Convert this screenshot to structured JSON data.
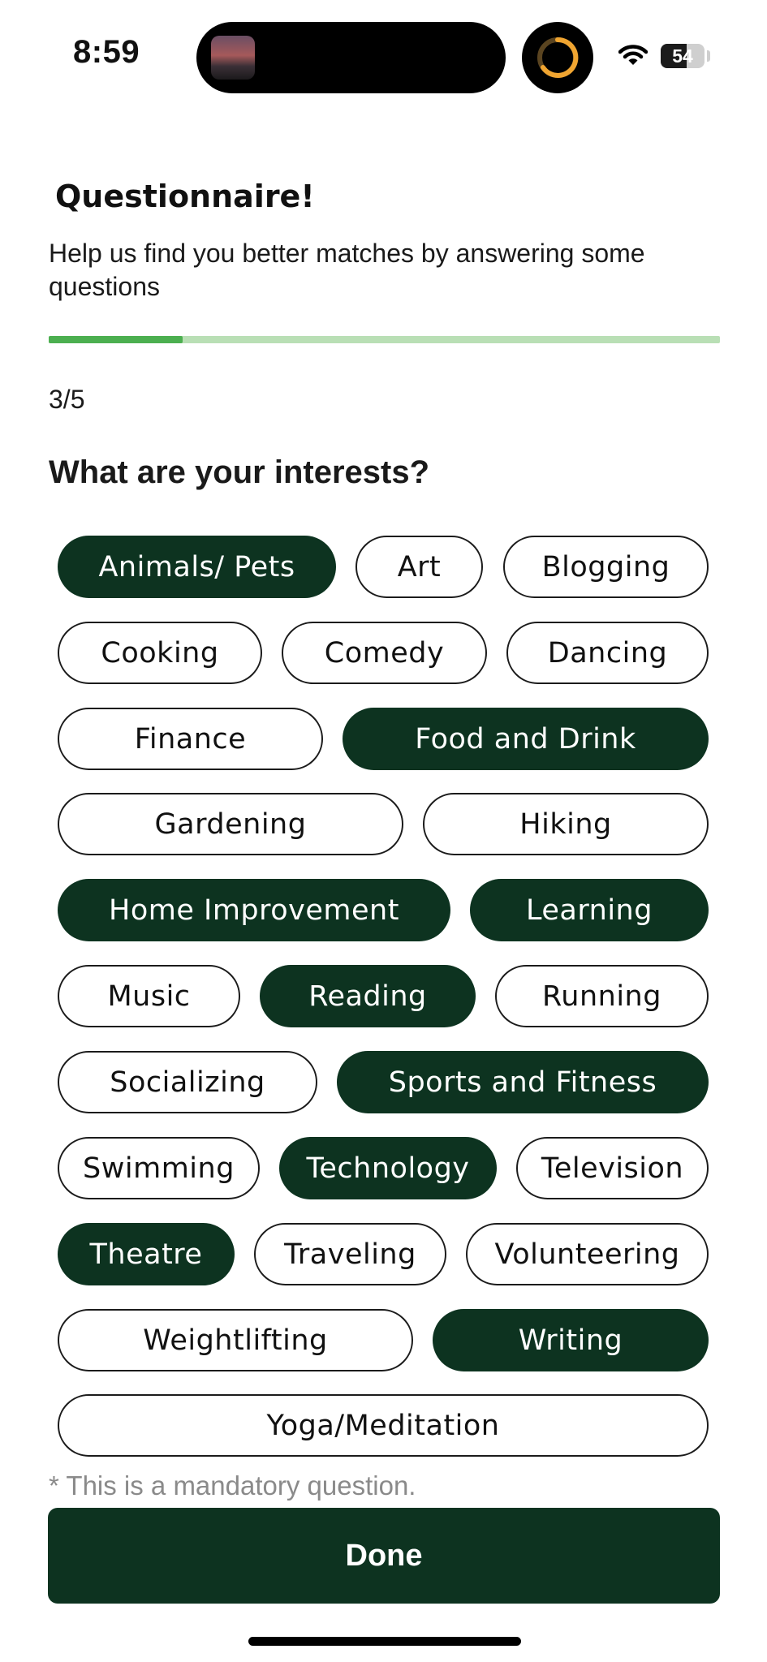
{
  "status_bar": {
    "time": "8:59",
    "battery": "54",
    "icons": [
      "photo-thumbnail-icon",
      "timer-ring-icon",
      "wifi-icon",
      "battery-icon"
    ]
  },
  "header": {
    "title": "Questionnaire!",
    "subtitle": "Help us find you better matches by answering some questions"
  },
  "progress": {
    "fraction": 0.2,
    "step_label": "3/5",
    "track_color": "#b9dfb5",
    "fill_color": "#4caf50"
  },
  "question": "What are your interests?",
  "interests": [
    {
      "label": "Animals/ Pets",
      "selected": true
    },
    {
      "label": "Art",
      "selected": false
    },
    {
      "label": "Blogging",
      "selected": false
    },
    {
      "label": "Cooking",
      "selected": false
    },
    {
      "label": "Comedy",
      "selected": false
    },
    {
      "label": "Dancing",
      "selected": false
    },
    {
      "label": "Finance",
      "selected": false
    },
    {
      "label": "Food and Drink",
      "selected": true
    },
    {
      "label": "Gardening",
      "selected": false
    },
    {
      "label": "Hiking",
      "selected": false
    },
    {
      "label": "Home Improvement",
      "selected": true
    },
    {
      "label": "Learning",
      "selected": true
    },
    {
      "label": "Music",
      "selected": false
    },
    {
      "label": "Reading",
      "selected": true
    },
    {
      "label": "Running",
      "selected": false
    },
    {
      "label": "Socializing",
      "selected": false
    },
    {
      "label": "Sports and Fitness",
      "selected": true
    },
    {
      "label": "Swimming",
      "selected": false
    },
    {
      "label": "Technology",
      "selected": true
    },
    {
      "label": "Television",
      "selected": false
    },
    {
      "label": "Theatre",
      "selected": true
    },
    {
      "label": "Traveling",
      "selected": false
    },
    {
      "label": "Volunteering",
      "selected": false
    },
    {
      "label": "Weightlifting",
      "selected": false
    },
    {
      "label": "Writing",
      "selected": true
    },
    {
      "label": "Yoga/Meditation",
      "selected": false
    }
  ],
  "footer": {
    "mandatory_note": "* This is a mandatory question.",
    "done_label": "Done"
  },
  "colors": {
    "accent_dark_green": "#0d3320",
    "chip_border": "#1b1b1b",
    "note_gray": "#8a8a8a"
  }
}
